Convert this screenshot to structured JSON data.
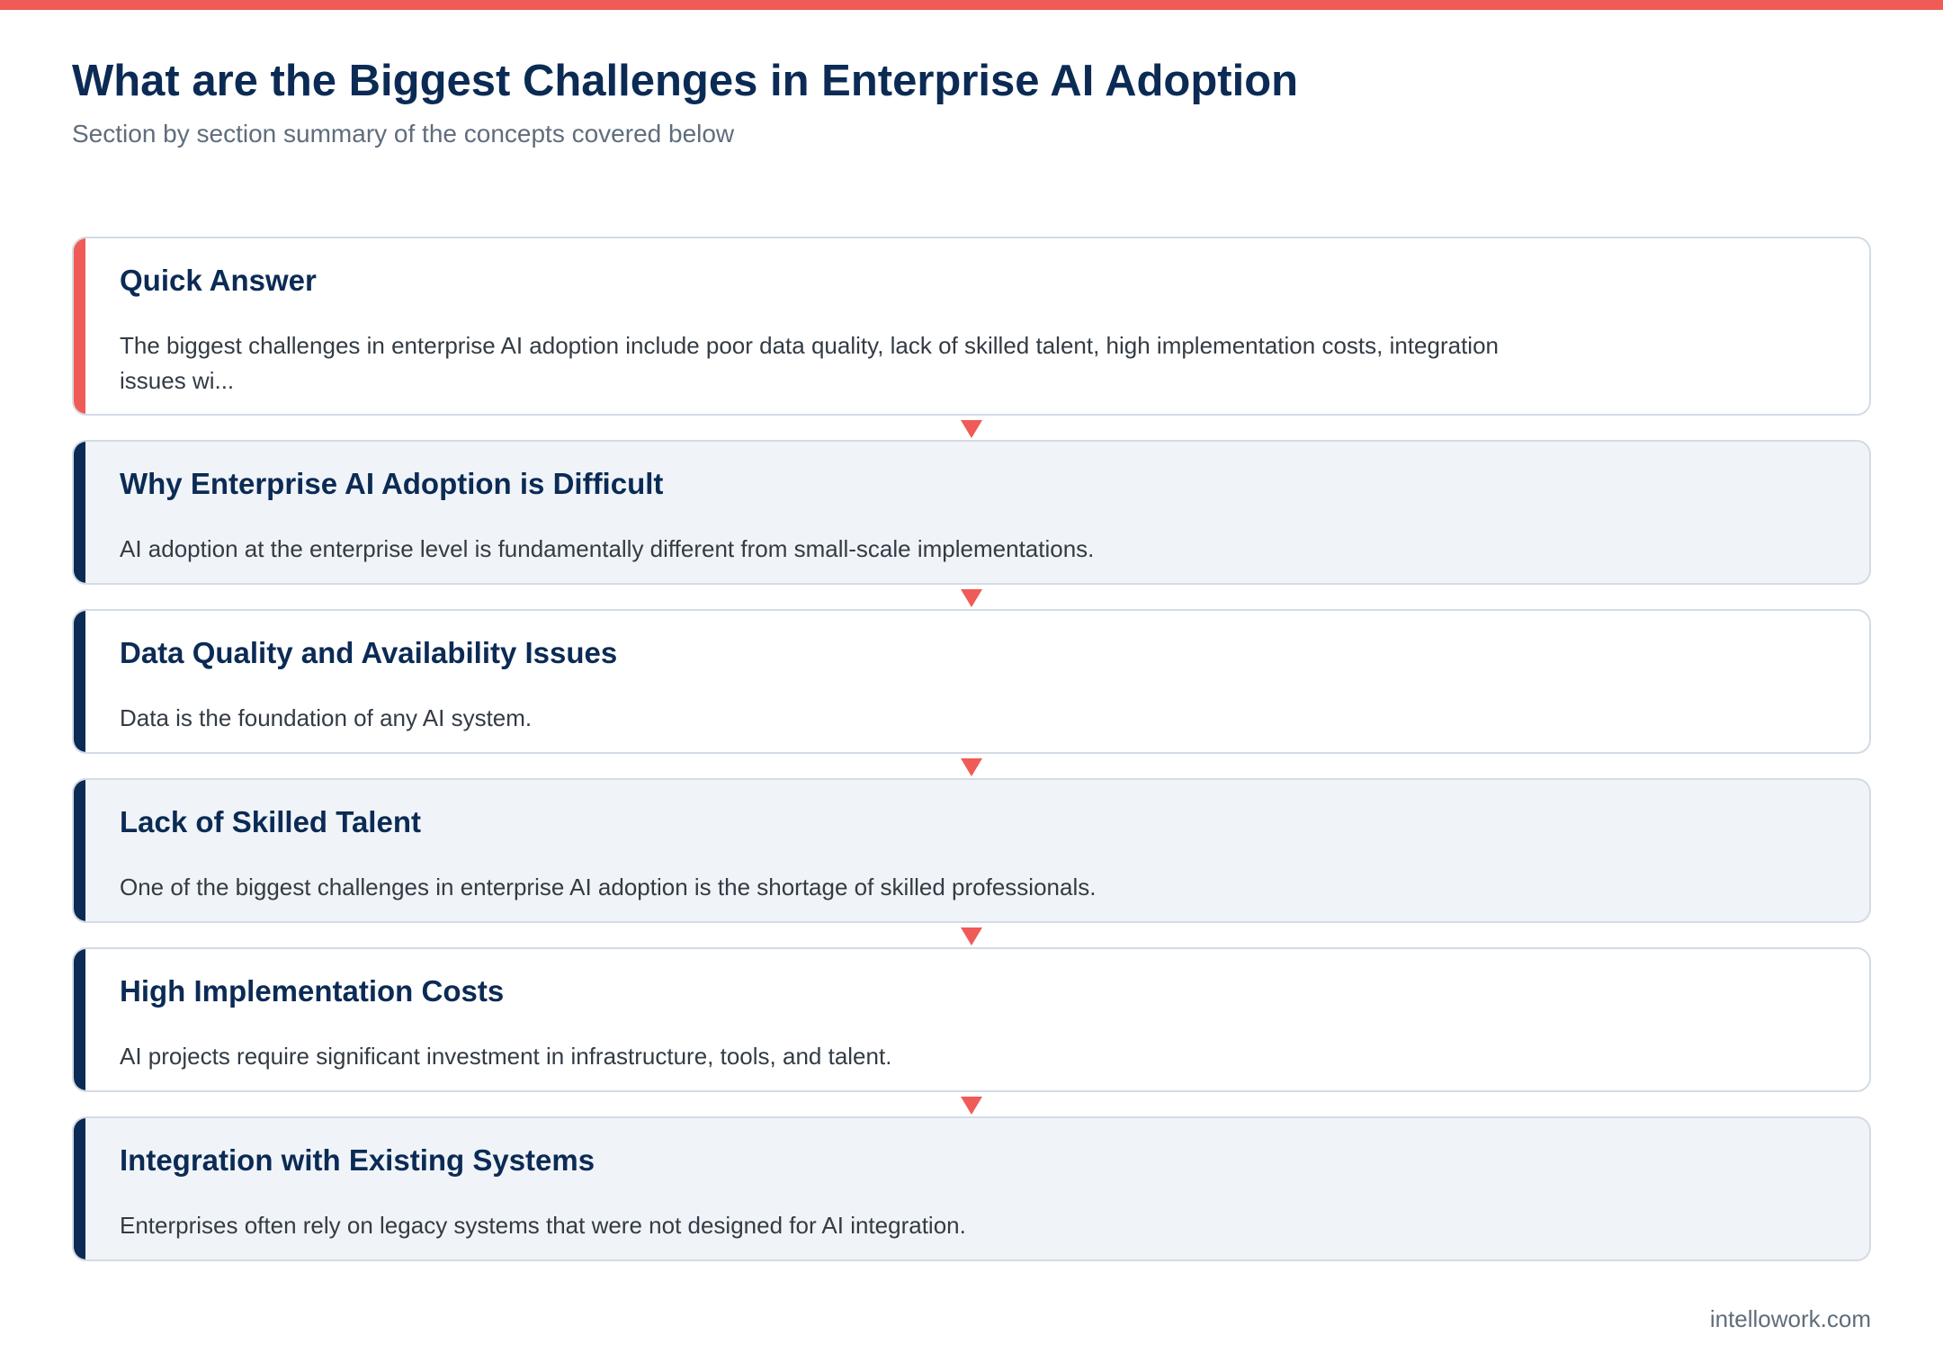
{
  "header": {
    "title": "What are the Biggest Challenges in Enterprise AI Adoption",
    "subtitle": "Section by section summary of the concepts covered below"
  },
  "sections": [
    {
      "title": "Quick Answer",
      "body": "The biggest challenges in enterprise AI adoption include poor data quality, lack of skilled talent, high implementation costs, integration issues wi..."
    },
    {
      "title": "Why Enterprise AI Adoption is Difficult",
      "body": "AI adoption at the enterprise level is fundamentally different from small-scale implementations."
    },
    {
      "title": "Data Quality and Availability Issues",
      "body": "Data is the foundation of any AI system."
    },
    {
      "title": "Lack of Skilled Talent",
      "body": "One of the biggest challenges in enterprise AI adoption is the shortage of skilled professionals."
    },
    {
      "title": "High Implementation Costs",
      "body": "AI projects require significant investment in infrastructure, tools, and talent."
    },
    {
      "title": "Integration with Existing Systems",
      "body": "Enterprises often rely on legacy systems that were not designed for AI integration."
    }
  ],
  "footer": {
    "site": "intellowork.com"
  },
  "colors": {
    "accent": "#ef5b57",
    "navy": "#0b2b55",
    "card_alt_bg": "#f0f4f8",
    "border": "#d3dbe4"
  },
  "icons": {
    "connector": "down-arrow-icon"
  }
}
